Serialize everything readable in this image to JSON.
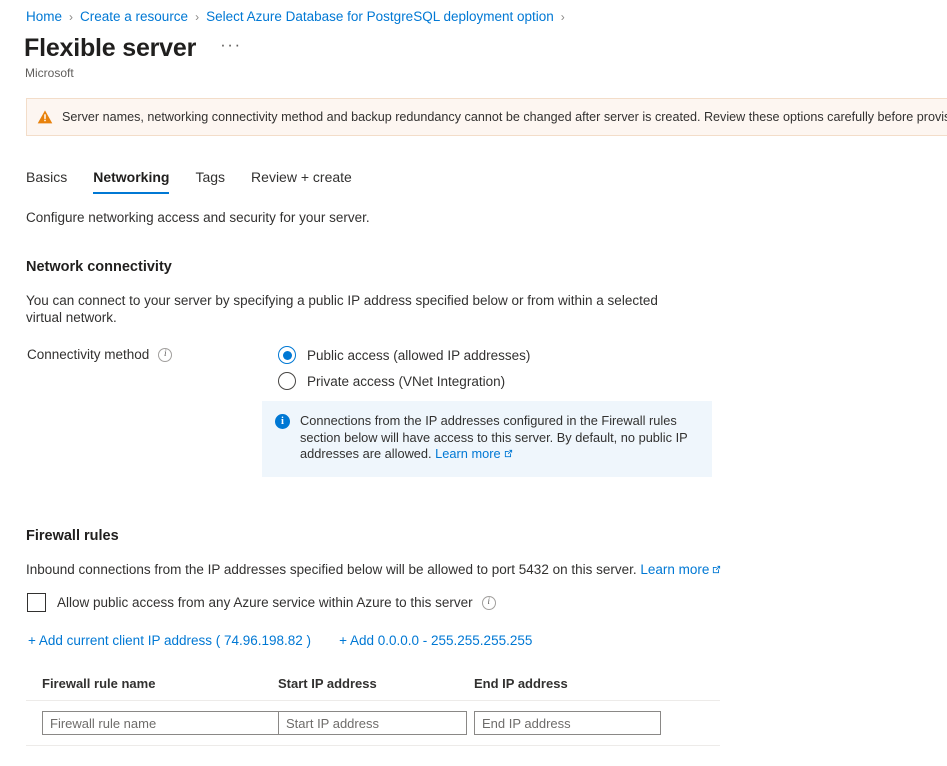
{
  "breadcrumb": {
    "items": [
      {
        "label": "Home"
      },
      {
        "label": "Create a resource"
      },
      {
        "label": "Select Azure Database for PostgreSQL deployment option"
      }
    ],
    "separator": "›"
  },
  "header": {
    "title": "Flexible server",
    "publisher": "Microsoft",
    "more_menu": "···"
  },
  "warning_banner": {
    "icon": "warning-triangle-icon",
    "text": "Server names, networking connectivity method and backup redundancy cannot be changed after server is created. Review these options carefully before provisioning"
  },
  "tabs": [
    {
      "label": "Basics",
      "active": false
    },
    {
      "label": "Networking",
      "active": true
    },
    {
      "label": "Tags",
      "active": false
    },
    {
      "label": "Review + create",
      "active": false
    }
  ],
  "page_description": "Configure networking access and security for your server.",
  "network_connectivity": {
    "heading": "Network connectivity",
    "description": "You can connect to your server by specifying a public IP address specified below or from within a selected virtual network.",
    "field_label": "Connectivity method",
    "options": [
      {
        "label": "Public access (allowed IP addresses)",
        "selected": true
      },
      {
        "label": "Private access (VNet Integration)",
        "selected": false
      }
    ],
    "info_box": {
      "text": "Connections from the IP addresses configured in the Firewall rules section below will have access to this server. By default, no public IP addresses are allowed. ",
      "link_label": "Learn more"
    }
  },
  "firewall_rules": {
    "heading": "Firewall rules",
    "description": "Inbound connections from the IP addresses specified below will be allowed to port 5432 on this server. ",
    "description_link": "Learn more",
    "allow_azure_checkbox": {
      "label": "Allow public access from any Azure service within Azure to this server",
      "checked": false
    },
    "add_links": [
      {
        "label": "+ Add current client IP address ( 74.96.198.82 )"
      },
      {
        "label": "+ Add 0.0.0.0 - 255.255.255.255"
      }
    ],
    "table": {
      "headers": [
        "Firewall rule name",
        "Start IP address",
        "End IP address"
      ],
      "rows": [
        {
          "name_value": "",
          "name_placeholder": "Firewall rule name",
          "start_value": "",
          "start_placeholder": "Start IP address",
          "end_value": "",
          "end_placeholder": "End IP address"
        }
      ]
    }
  },
  "colors": {
    "accent": "#0078d4",
    "warning_bg": "#fdf6f1",
    "warning_icon": "#d83b01",
    "info_bg": "#eff6fc",
    "text": "#323130"
  }
}
